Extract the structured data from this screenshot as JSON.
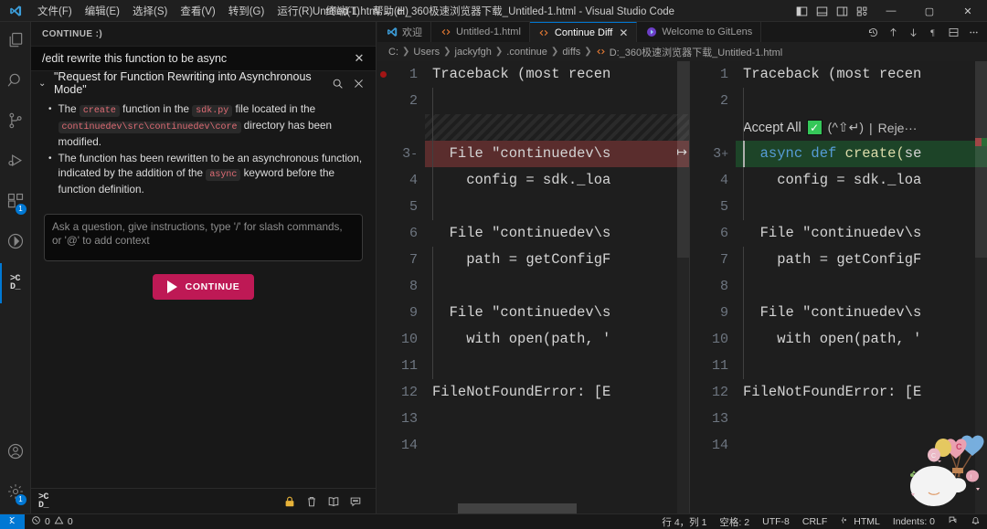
{
  "titlebar": {
    "logo_icon": "vscode-logo-icon",
    "menus": [
      {
        "label": "文件(F)"
      },
      {
        "label": "编辑(E)"
      },
      {
        "label": "选择(S)"
      },
      {
        "label": "查看(V)"
      },
      {
        "label": "转到(G)"
      },
      {
        "label": "运行(R)"
      },
      {
        "label": "终端(T)"
      },
      {
        "label": "帮助(H)"
      }
    ],
    "title": "Untitled-1.html ↔ d:_360极速浏览器下载_Untitled-1.html - Visual Studio Code",
    "layout_icons": [
      "toggle-primary-sidebar-icon",
      "toggle-panel-icon",
      "toggle-secondary-sidebar-icon",
      "customize-layout-icon"
    ],
    "window_buttons": {
      "minimize": "—",
      "maximize": "▢",
      "close": "✕"
    }
  },
  "activitybar": {
    "items": [
      {
        "name": "explorer",
        "icon": "files-icon",
        "badge": "",
        "active": false
      },
      {
        "name": "search",
        "icon": "search-icon",
        "badge": "",
        "active": false
      },
      {
        "name": "source-control",
        "icon": "source-control-icon",
        "badge": "",
        "active": false
      },
      {
        "name": "run-and-debug",
        "icon": "run-debug-icon",
        "badge": "",
        "active": false
      },
      {
        "name": "extensions",
        "icon": "extensions-icon",
        "badge": "1",
        "active": false
      },
      {
        "name": "gitlens",
        "icon": "gitlens-icon",
        "badge": "",
        "active": false
      },
      {
        "name": "continue",
        "icon": "continue-icon",
        "badge": "",
        "active": true
      }
    ],
    "bottom_items": [
      {
        "name": "accounts",
        "icon": "account-icon",
        "badge": ""
      },
      {
        "name": "manage",
        "icon": "gear-icon",
        "badge": "1"
      }
    ]
  },
  "sidebar": {
    "header_title": "CONTINUE :)",
    "command": {
      "text": "/edit rewrite this function to be async",
      "close_icon": "close-icon"
    },
    "response": {
      "chevron_icon": "chevron-down-icon",
      "title": "\"Request for Function Rewriting into Asynchronous Mode\"",
      "search_icon": "search-icon",
      "close_icon": "close-icon",
      "bullets": [
        {
          "parts": [
            {
              "t": "text",
              "v": "The "
            },
            {
              "t": "code",
              "v": "create"
            },
            {
              "t": "text",
              "v": " function in the "
            },
            {
              "t": "code",
              "v": "sdk.py"
            },
            {
              "t": "text",
              "v": " file located in the "
            },
            {
              "t": "code",
              "v": "continuedev\\src\\continuedev\\core"
            },
            {
              "t": "text",
              "v": " directory has been modified."
            }
          ]
        },
        {
          "parts": [
            {
              "t": "text",
              "v": "The function has been rewritten to be an asynchronous function, indicated by the addition of the "
            },
            {
              "t": "code",
              "v": "async"
            },
            {
              "t": "text",
              "v": " keyword before the function definition."
            }
          ]
        }
      ]
    },
    "prompt_placeholder": "Ask a question, give instructions, type '/' for slash commands, or '@' to add context",
    "continue_button": {
      "label": "CONTINUE",
      "icon": "play-icon",
      "color": "#be1955"
    },
    "footer": {
      "logo": "continue-logo-icon",
      "icons": [
        "lock-icon",
        "trash-icon",
        "book-icon",
        "comment-icon"
      ],
      "lock_color": "#e8b339"
    }
  },
  "editor": {
    "tabs": [
      {
        "label": "欢迎",
        "icon": "vscode-icon",
        "active": false,
        "closable": false
      },
      {
        "label": "Untitled-1.html",
        "icon": "html-icon",
        "active": false,
        "closable": false
      },
      {
        "label": "Continue Diff",
        "icon": "html-icon",
        "active": true,
        "closable": true
      },
      {
        "label": "Welcome to GitLens",
        "icon": "gitlens-icon",
        "active": false,
        "closable": false
      }
    ],
    "tab_actions": [
      "history-icon",
      "arrow-up-icon",
      "arrow-down-icon",
      "pilcrow-icon",
      "split-editor-icon",
      "more-actions-icon"
    ],
    "breadcrumb": [
      "C:",
      "Users",
      "jackyfgh",
      ".continue",
      "diffs",
      "D:_360极速浏览器下载_Untitled-1.html"
    ],
    "breadcrumb_file_icon": "html-icon"
  },
  "diff": {
    "accept_bar": {
      "accept_label": "Accept All",
      "check_icon": "check-icon",
      "accept_keys": "(^⇧↵)",
      "separator": "|",
      "reject_label": "Reje···"
    },
    "left": {
      "lines": [
        {
          "n": "1",
          "sign": "",
          "text": "Traceback (most recen",
          "kind": "normal"
        },
        {
          "n": "2",
          "sign": "",
          "text": "",
          "kind": "normal"
        },
        {
          "n": "",
          "sign": "",
          "text": "",
          "kind": "hatch"
        },
        {
          "n": "3",
          "sign": "-",
          "text": "  File \"continuedev\\s",
          "kind": "del"
        },
        {
          "n": "4",
          "sign": "",
          "text": "    config = sdk._loa",
          "kind": "normal"
        },
        {
          "n": "5",
          "sign": "",
          "text": "",
          "kind": "normal"
        },
        {
          "n": "6",
          "sign": "",
          "text": "  File \"continuedev\\s",
          "kind": "normal"
        },
        {
          "n": "7",
          "sign": "",
          "text": "    path = getConfigF",
          "kind": "normal"
        },
        {
          "n": "8",
          "sign": "",
          "text": "",
          "kind": "normal"
        },
        {
          "n": "9",
          "sign": "",
          "text": "  File \"continuedev\\s",
          "kind": "normal"
        },
        {
          "n": "10",
          "sign": "",
          "text": "    with open(path, '",
          "kind": "normal"
        },
        {
          "n": "11",
          "sign": "",
          "text": "",
          "kind": "normal",
          "breakpoint": true
        },
        {
          "n": "12",
          "sign": "",
          "text": "FileNotFoundError: [E",
          "kind": "normal"
        },
        {
          "n": "13",
          "sign": "",
          "text": "",
          "kind": "normal"
        },
        {
          "n": "14",
          "sign": "",
          "text": "",
          "kind": "normal"
        }
      ]
    },
    "right": {
      "lines": [
        {
          "n": "1",
          "sign": "",
          "text": "Traceback (most recen",
          "kind": "normal"
        },
        {
          "n": "2",
          "sign": "",
          "text": "",
          "kind": "normal"
        },
        {
          "n": "",
          "sign": "",
          "text": "",
          "kind": "accept"
        },
        {
          "n": "3",
          "sign": "+",
          "text": "  async def create(se",
          "kind": "ins"
        },
        {
          "n": "4",
          "sign": "",
          "text": "    config = sdk._loa",
          "kind": "normal"
        },
        {
          "n": "5",
          "sign": "",
          "text": "",
          "kind": "normal"
        },
        {
          "n": "6",
          "sign": "",
          "text": "  File \"continuedev\\s",
          "kind": "normal"
        },
        {
          "n": "7",
          "sign": "",
          "text": "    path = getConfigF",
          "kind": "normal"
        },
        {
          "n": "8",
          "sign": "",
          "text": "",
          "kind": "normal"
        },
        {
          "n": "9",
          "sign": "",
          "text": "  File \"continuedev\\s",
          "kind": "normal"
        },
        {
          "n": "10",
          "sign": "",
          "text": "    with open(path, '",
          "kind": "normal"
        },
        {
          "n": "11",
          "sign": "",
          "text": "",
          "kind": "normal"
        },
        {
          "n": "12",
          "sign": "",
          "text": "FileNotFoundError: [E",
          "kind": "normal"
        },
        {
          "n": "13",
          "sign": "",
          "text": "",
          "kind": "normal"
        },
        {
          "n": "14",
          "sign": "",
          "text": "",
          "kind": "normal"
        }
      ]
    }
  },
  "statusbar": {
    "remote_icon": "remote-window-icon",
    "problems": {
      "error_icon": "error-icon",
      "errors": "0",
      "warning_icon": "warning-icon",
      "warnings": "0"
    },
    "right_items": [
      {
        "name": "cursor-position",
        "label": "行 4，列 1"
      },
      {
        "name": "indentation",
        "label": "空格: 2"
      },
      {
        "name": "encoding",
        "label": "UTF-8"
      },
      {
        "name": "eol",
        "label": "CRLF"
      },
      {
        "name": "language-mode",
        "label": "HTML",
        "icon": "html-lang-icon"
      },
      {
        "name": "indents",
        "label": "Indents: 0"
      },
      {
        "name": "screen-reader",
        "label": "",
        "icon": "screencast-icon"
      },
      {
        "name": "notifications",
        "label": "",
        "icon": "bell-icon"
      }
    ]
  }
}
